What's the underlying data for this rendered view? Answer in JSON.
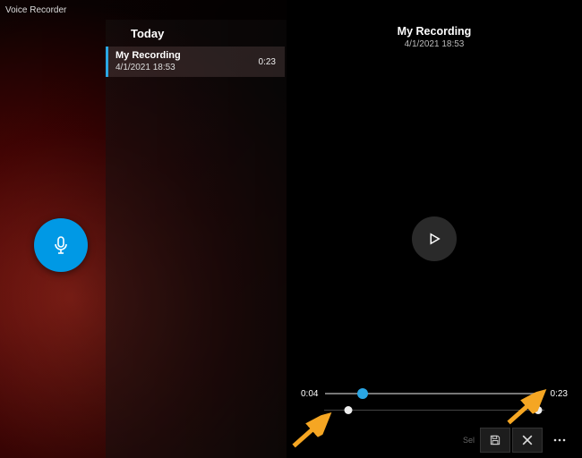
{
  "window": {
    "title": "Voice Recorder"
  },
  "colors": {
    "accent": "#2aa6e4"
  },
  "left": {
    "header": "Today",
    "items": [
      {
        "title": "My Recording",
        "datetime": "4/1/2021 18:53",
        "duration": "0:23"
      }
    ]
  },
  "detail": {
    "title": "My Recording",
    "datetime": "4/1/2021 18:53",
    "current_time": "0:04",
    "total_time": "0:23",
    "play_progress_pct": 17,
    "markers_pct": [
      11,
      97
    ]
  },
  "actions": {
    "select_label": "Sel",
    "save_icon": "save-icon",
    "delete_icon": "close-icon",
    "more_icon": "more-icon"
  }
}
